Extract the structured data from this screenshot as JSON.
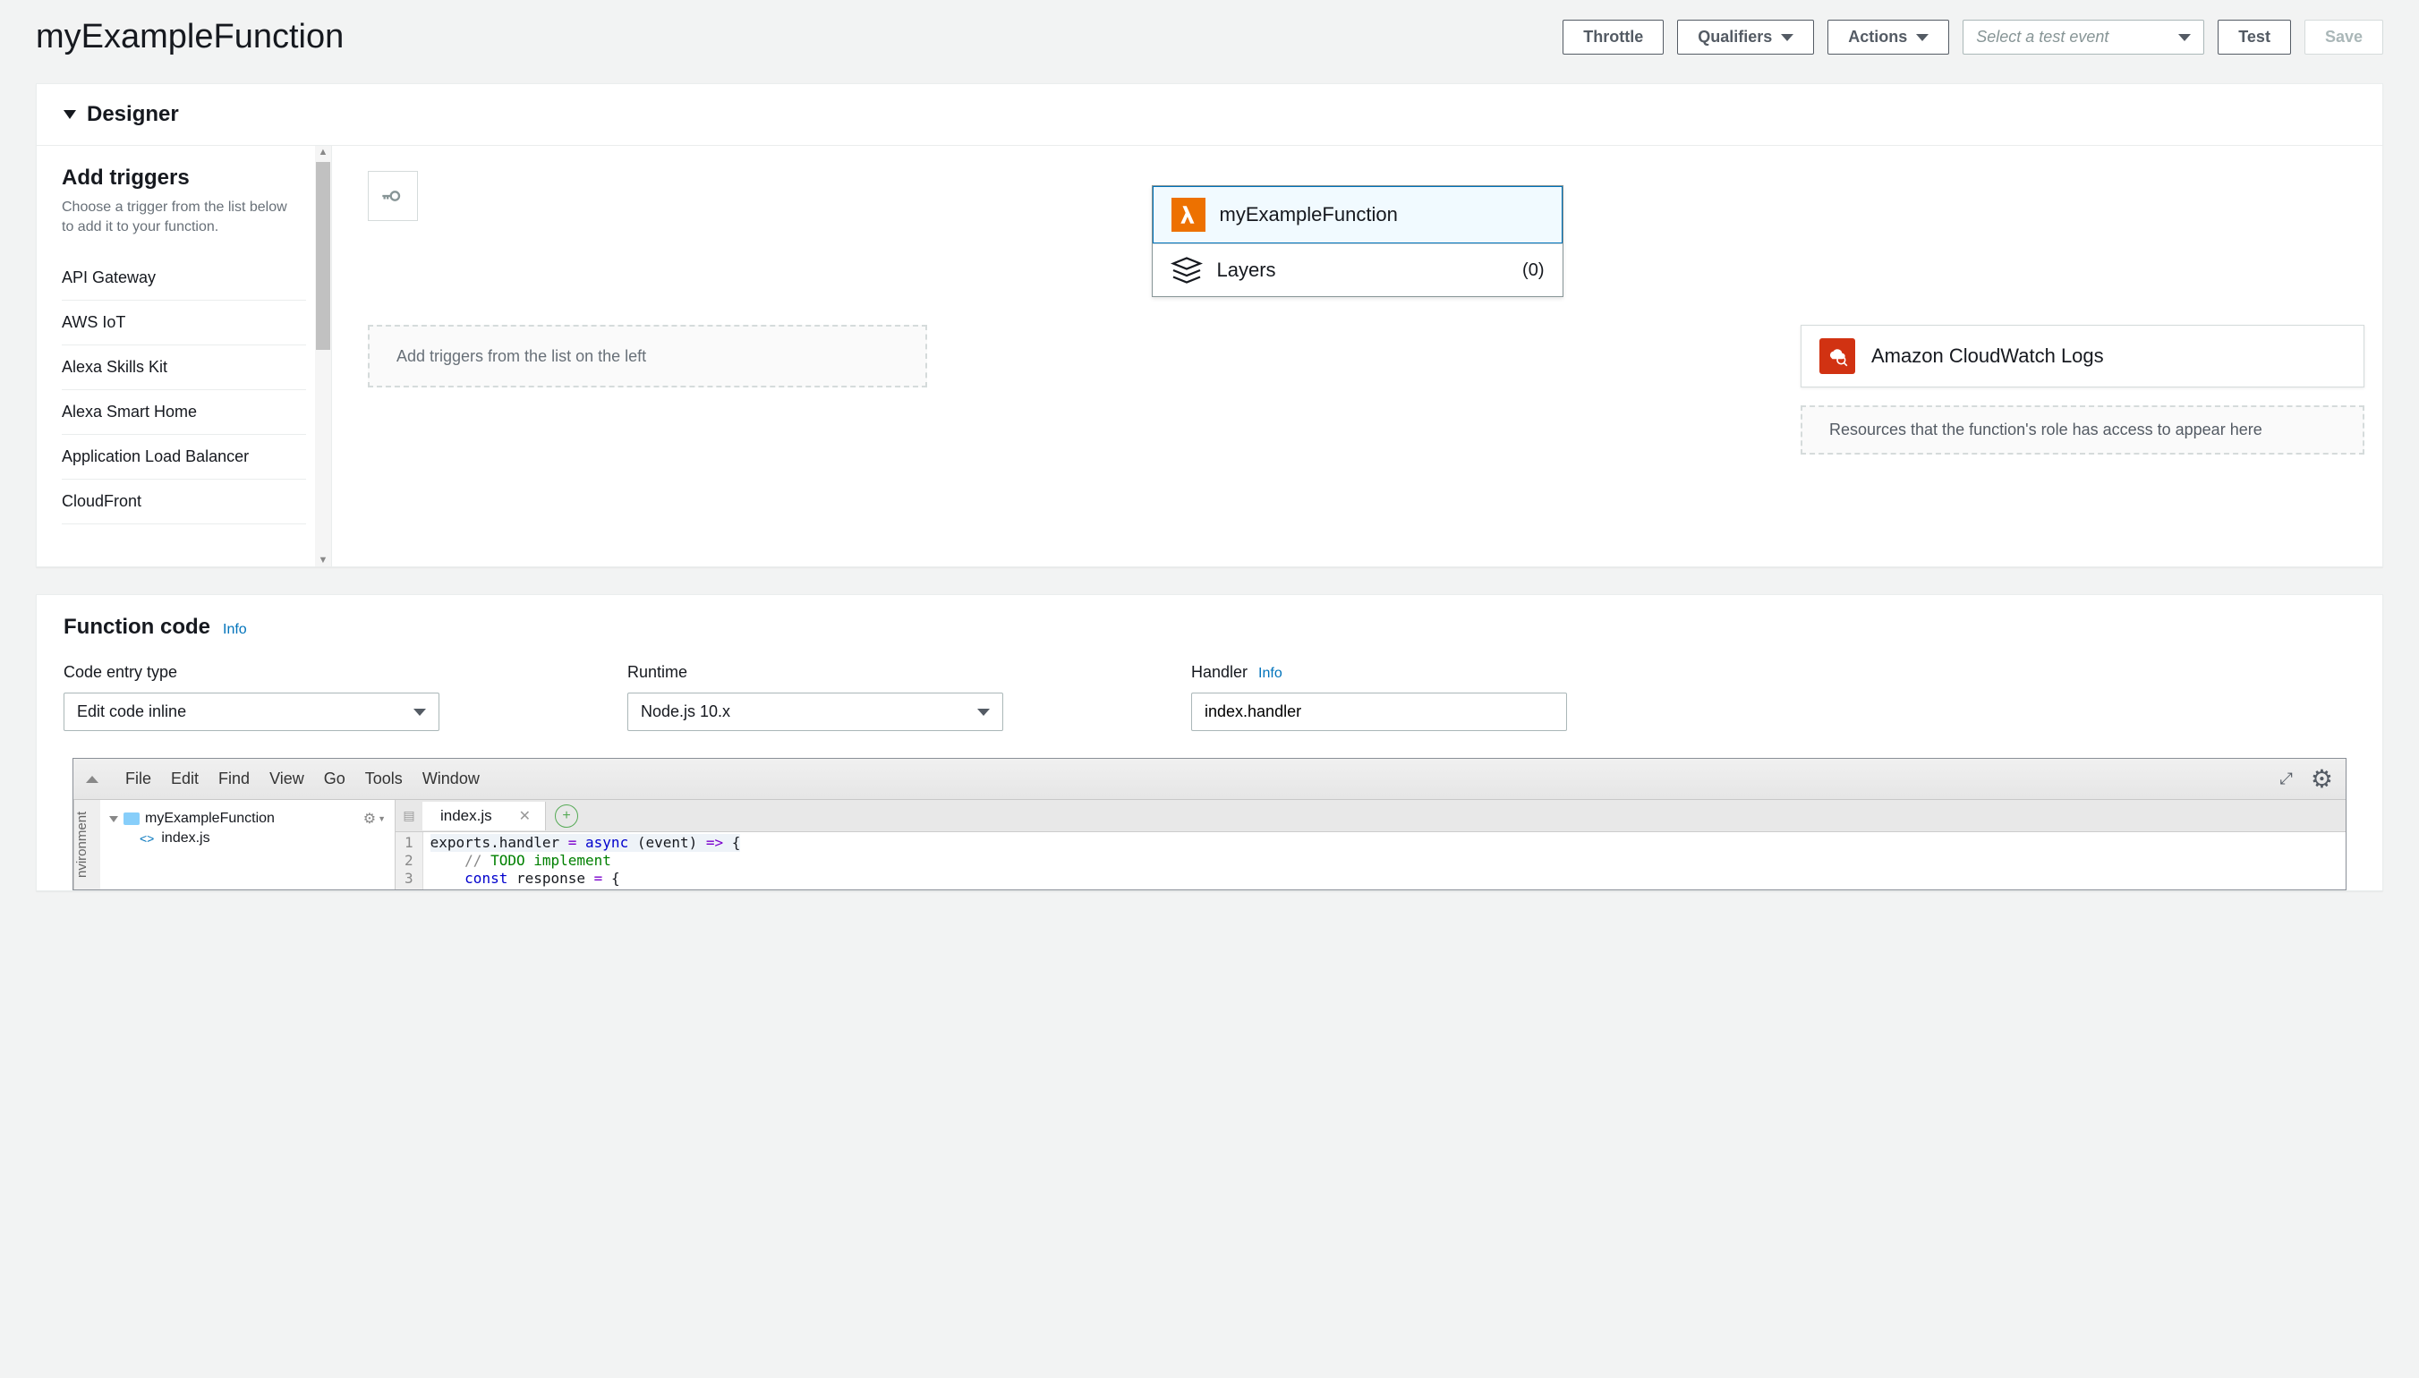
{
  "header": {
    "title": "myExampleFunction",
    "throttle": "Throttle",
    "qualifiers": "Qualifiers",
    "actions": "Actions",
    "select_event_placeholder": "Select a test event",
    "test": "Test",
    "save": "Save"
  },
  "designer": {
    "title": "Designer",
    "sidebar": {
      "title": "Add triggers",
      "desc": "Choose a trigger from the list below to add it to your function.",
      "items": [
        "API Gateway",
        "AWS IoT",
        "Alexa Skills Kit",
        "Alexa Smart Home",
        "Application Load Balancer",
        "CloudFront"
      ]
    },
    "function_name": "myExampleFunction",
    "layers_label": "Layers",
    "layers_count": "(0)",
    "trigger_placeholder": "Add triggers from the list on the left",
    "destination_label": "Amazon CloudWatch Logs",
    "role_placeholder": "Resources that the function's role has access to appear here"
  },
  "code": {
    "title": "Function code",
    "info": "Info",
    "entry_label": "Code entry type",
    "entry_value": "Edit code inline",
    "runtime_label": "Runtime",
    "runtime_value": "Node.js 10.x",
    "handler_label": "Handler",
    "handler_value": "index.handler"
  },
  "ide": {
    "menu": [
      "File",
      "Edit",
      "Find",
      "View",
      "Go",
      "Tools",
      "Window"
    ],
    "env_label": "nvironment",
    "project_name": "myExampleFunction",
    "file_name": "index.js",
    "tab_name": "index.js",
    "lines": {
      "l1a": "exports.handler ",
      "l1b": "= ",
      "l1c": "async",
      "l1d": " (event) ",
      "l1e": "=>",
      "l1f": " {",
      "l2a": "    ",
      "l2b": "// ",
      "l2c": "TODO",
      "l2d": " implement",
      "l3a": "    ",
      "l3b": "const",
      "l3c": " response ",
      "l3d": "= ",
      "l3e": "{"
    }
  }
}
